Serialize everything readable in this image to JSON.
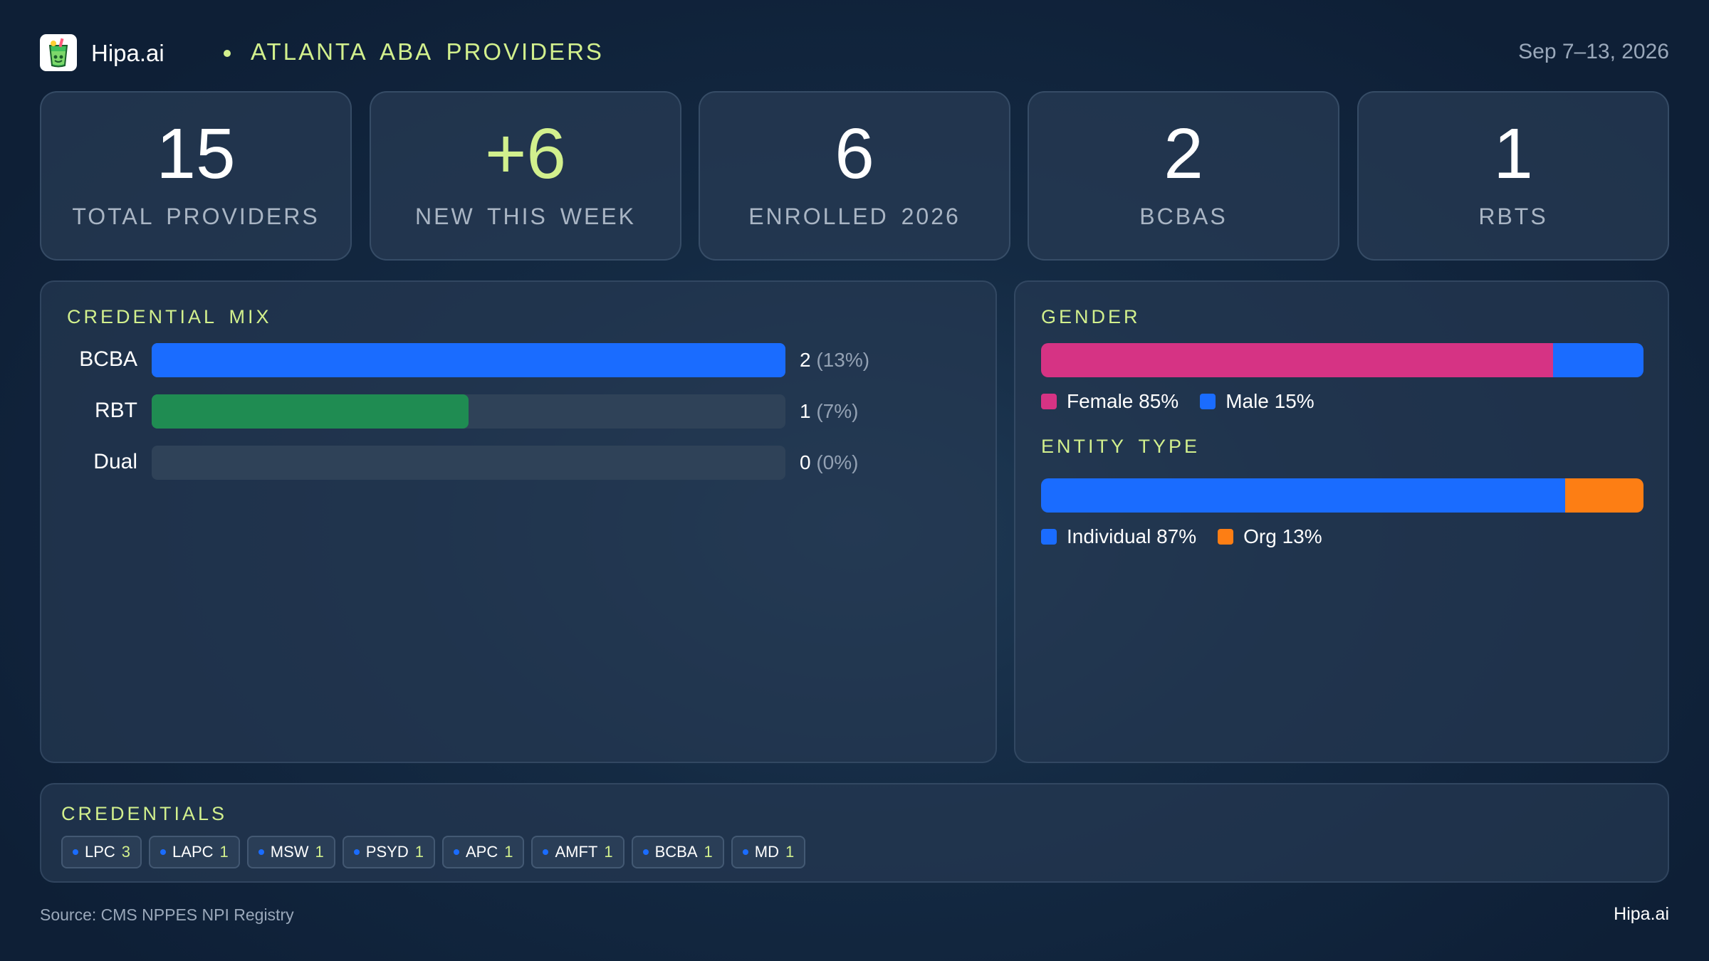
{
  "header": {
    "brand": "Hipa.ai",
    "region": "ATLANTA ABA PROVIDERS",
    "date_range": "Sep 7–13, 2026"
  },
  "stats": [
    {
      "value": "15",
      "label": "TOTAL PROVIDERS",
      "color": "#ffffff"
    },
    {
      "value": "+6",
      "label": "NEW THIS WEEK",
      "color": "#d2f08d"
    },
    {
      "value": "6",
      "label": "ENROLLED 2026",
      "color": "#ffffff"
    },
    {
      "value": "2",
      "label": "BCBAS",
      "color": "#ffffff"
    },
    {
      "value": "1",
      "label": "RBTS",
      "color": "#ffffff"
    }
  ],
  "chart_data": [
    {
      "type": "bar",
      "title": "CREDENTIAL MIX",
      "categories": [
        "BCBA",
        "RBT",
        "Dual"
      ],
      "values": [
        2,
        1,
        0
      ],
      "value_labels": [
        "2",
        "1",
        "0"
      ],
      "percent_labels": [
        "(13%)",
        "(7%)",
        "(0%)"
      ],
      "xlim": [
        0,
        2
      ],
      "colors": [
        "#1a6cff",
        "#1f8c52",
        "#1a6cff"
      ]
    },
    {
      "type": "bar",
      "title": "GENDER",
      "stacked": true,
      "series": [
        {
          "name": "Female 85%",
          "value": 85,
          "color": "#d63384"
        },
        {
          "name": "Male 15%",
          "value": 15,
          "color": "#1a6cff"
        }
      ]
    },
    {
      "type": "bar",
      "title": "ENTITY TYPE",
      "stacked": true,
      "series": [
        {
          "name": "Individual 87%",
          "value": 87,
          "color": "#1a6cff"
        },
        {
          "name": "Org 13%",
          "value": 13,
          "color": "#fd7e14"
        }
      ]
    }
  ],
  "credentials": {
    "title": "CREDENTIALS",
    "chips": [
      {
        "name": "LPC",
        "count": "3"
      },
      {
        "name": "LAPC",
        "count": "1"
      },
      {
        "name": "MSW",
        "count": "1"
      },
      {
        "name": "PSYD",
        "count": "1"
      },
      {
        "name": "APC",
        "count": "1"
      },
      {
        "name": "AMFT",
        "count": "1"
      },
      {
        "name": "BCBA",
        "count": "1"
      },
      {
        "name": "MD",
        "count": "1"
      }
    ]
  },
  "footer": {
    "source": "Source: CMS NPPES NPI Registry",
    "brand": "Hipa.ai"
  },
  "colors": {
    "accent": "#d2f08d",
    "blue": "#1a6cff",
    "green": "#1f8c52",
    "pink": "#d63384",
    "orange": "#fd7e14"
  }
}
